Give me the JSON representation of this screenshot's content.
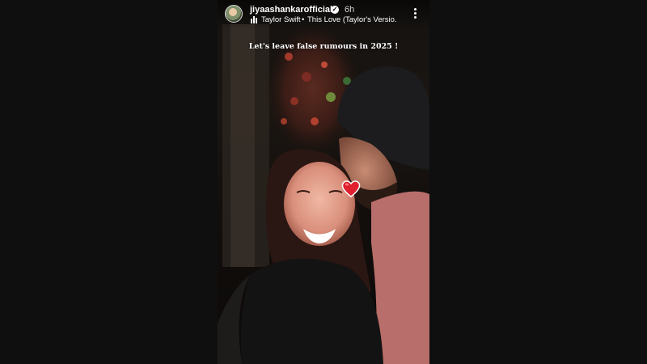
{
  "story": {
    "username": "jiyaashankarofficial",
    "timestamp": "6h",
    "music": {
      "artist": "Taylor Swift",
      "separator": "•",
      "track": "This Love (Taylor's Versio..."
    },
    "caption": "Let's leave false rumours in 2025 !"
  },
  "icons": {
    "verified": "verified-badge-icon",
    "music": "music-bars-icon",
    "more": "more-vertical-icon",
    "sticker": "red-heart-emoji"
  },
  "colors": {
    "background": "#0f0f0f",
    "text": "#ffffff",
    "heart": "#e0202e"
  }
}
